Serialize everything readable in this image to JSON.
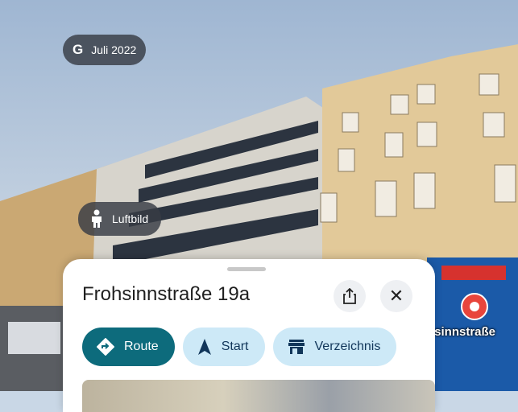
{
  "imagery_date": {
    "logo": "G",
    "label": "Juli 2022"
  },
  "aerial_button": {
    "label": "Luftbild"
  },
  "place_sheet": {
    "title": "Frohsinnstraße 19a",
    "actions": [
      {
        "label": "Route"
      },
      {
        "label": "Start"
      },
      {
        "label": "Verzeichnis"
      }
    ]
  },
  "map_marker": {
    "label": "nsinnstraße"
  },
  "colors": {
    "primary": "#0d6b7c",
    "chip_bg": "#cde9f7",
    "marker": "#e8453c"
  }
}
